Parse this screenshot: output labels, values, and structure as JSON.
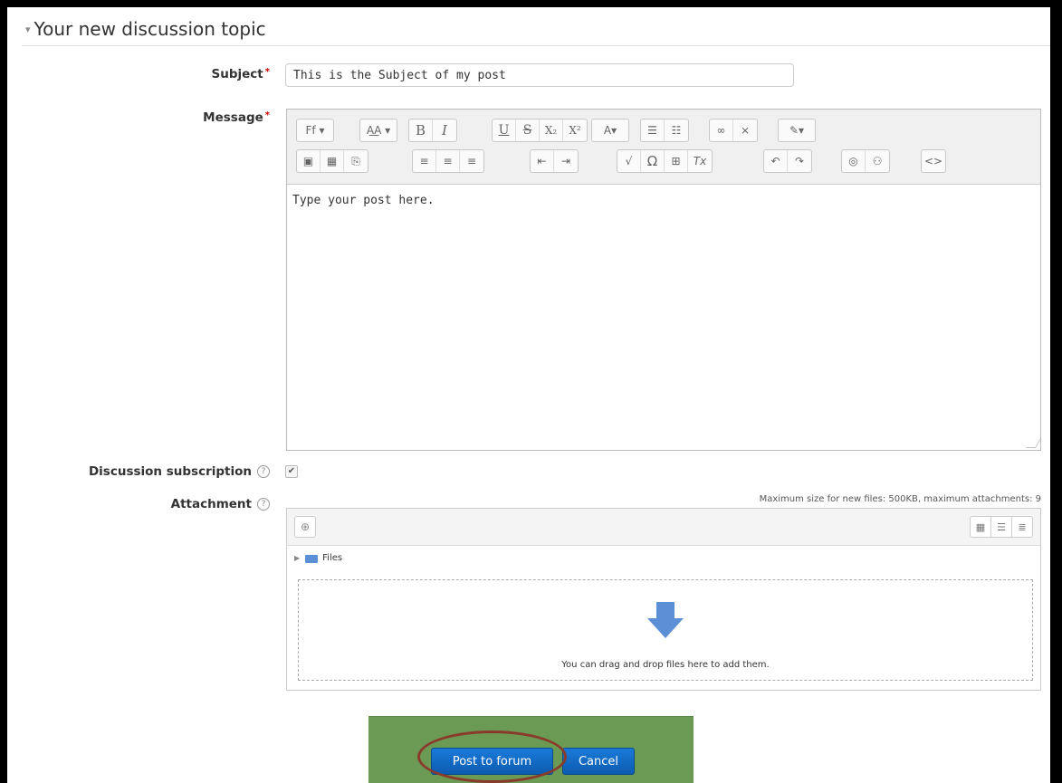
{
  "section": {
    "title": "Your new discussion topic"
  },
  "subject": {
    "label": "Subject",
    "required": "*",
    "value": "This is the Subject of my post"
  },
  "message": {
    "label": "Message",
    "required": "*",
    "text": "Type your post here.",
    "toolbar_row1": [
      "Ff ▾",
      "A͟A ▾",
      "B",
      "I",
      "U",
      "S",
      "X₂",
      "X²",
      "A ▾",
      "list-bulleted",
      "list-numbered",
      "link",
      "unlink",
      "spellcheck ▾"
    ],
    "toolbar_row2": [
      "image",
      "media",
      "paste",
      "align-left",
      "align-center",
      "align-right",
      "outdent",
      "indent",
      "equation",
      "Ω",
      "table",
      "clear-formatting",
      "undo",
      "redo",
      "accessibility-checker",
      "screenreader-helper",
      "html"
    ]
  },
  "subscription": {
    "label": "Discussion subscription",
    "help": "?",
    "checked": true,
    "check_glyph": "✔"
  },
  "attachment": {
    "label": "Attachment",
    "help": "?",
    "max_info": "Maximum size for new files: 500KB, maximum attachments: 9",
    "folder_label": "Files",
    "drop_text": "You can drag and drop files here to add them."
  },
  "buttons": {
    "post": "Post to forum",
    "cancel": "Cancel"
  },
  "colors": {
    "primary_button": "#0c5cb0",
    "annotation_bg": "#6b9a55",
    "annotation_circle": "#8a3a2a",
    "required": "#cc0000"
  }
}
